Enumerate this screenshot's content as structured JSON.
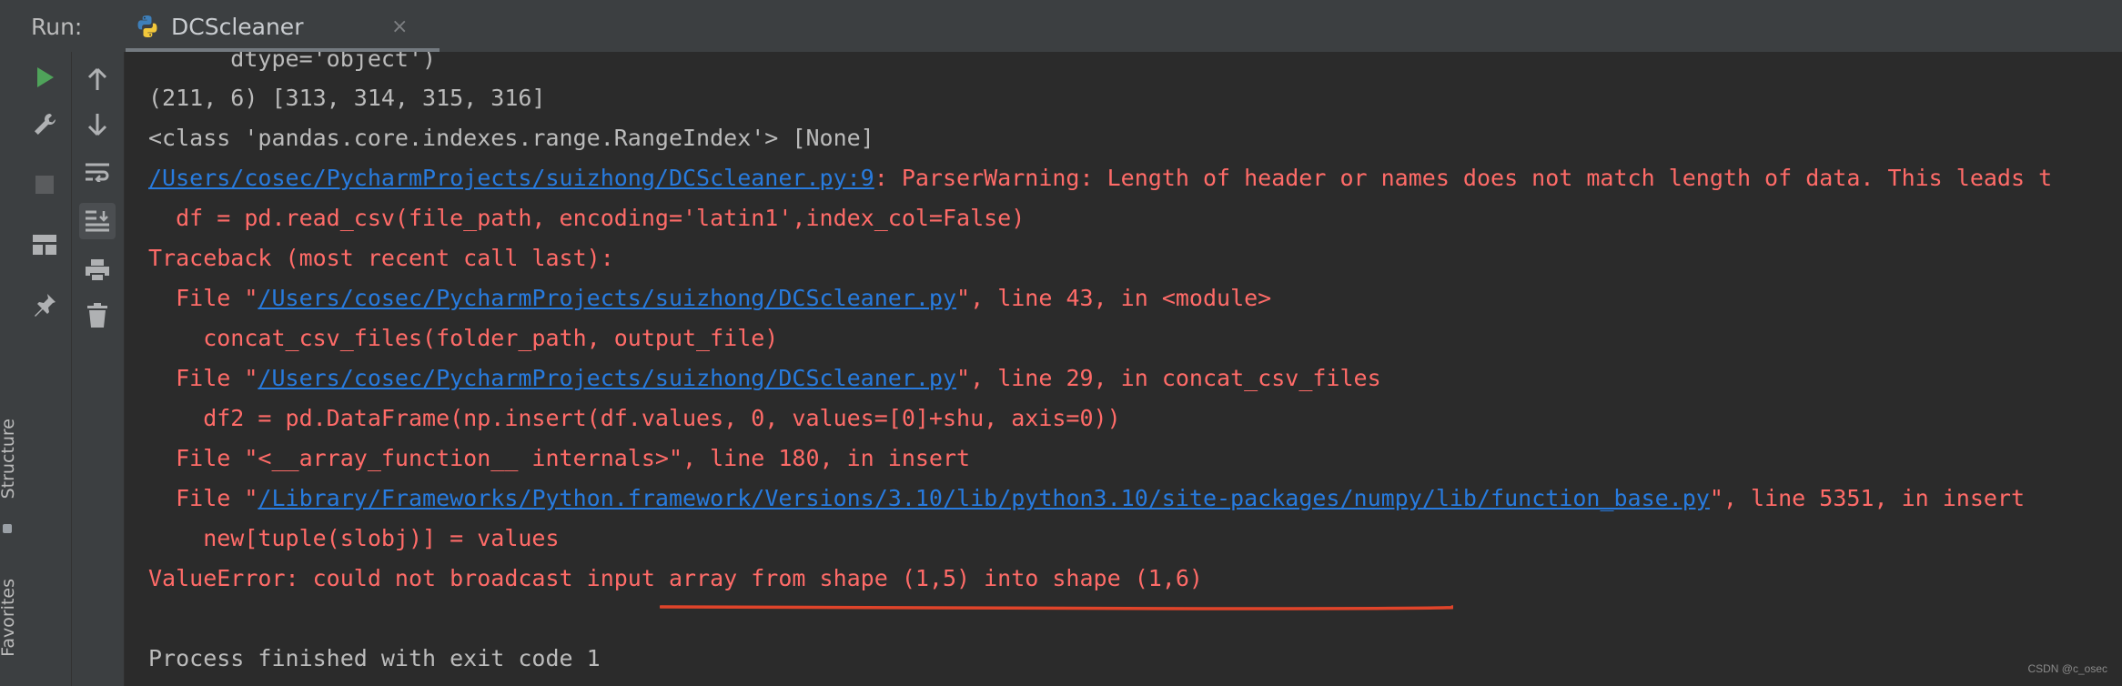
{
  "run_panel": {
    "label": "Run:",
    "tab": {
      "title": "DCScleaner",
      "close_glyph": "×",
      "icon": "python-icon"
    }
  },
  "side_tabs": [
    {
      "label": "Structure"
    },
    {
      "label": "Favorites"
    }
  ],
  "toolbar_left": [
    {
      "name": "rerun-icon",
      "tooltip": "Rerun"
    },
    {
      "name": "wrench-icon",
      "tooltip": "Edit Configuration"
    },
    {
      "name": "stop-icon",
      "tooltip": "Stop"
    },
    {
      "name": "layout-icon",
      "tooltip": "Restore Layout"
    },
    {
      "name": "pin-icon",
      "tooltip": "Pin Tab"
    }
  ],
  "toolbar_right": [
    {
      "name": "arrow-up-icon"
    },
    {
      "name": "arrow-down-icon"
    },
    {
      "name": "soft-wrap-icon"
    },
    {
      "name": "scroll-to-end-icon"
    },
    {
      "name": "print-icon"
    },
    {
      "name": "trash-icon"
    }
  ],
  "console": {
    "line0": "      dtype='object')",
    "line1": "(211, 6) [313, 314, 315, 316]",
    "line2": "<class 'pandas.core.indexes.range.RangeIndex'> [None]",
    "line3_link": "/Users/cosec/PycharmProjects/suizhong/DCScleaner.py:9",
    "line3_text": ": ParserWarning: Length of header or names does not match length of data. This leads t",
    "line4": "  df = pd.read_csv(file_path, encoding='latin1',index_col=False)",
    "line5": "Traceback (most recent call last):",
    "line6_pre": "  File \"",
    "line6_link": "/Users/cosec/PycharmProjects/suizhong/DCScleaner.py",
    "line6_post": "\", line 43, in <module>",
    "line7": "    concat_csv_files(folder_path, output_file)",
    "line8_pre": "  File \"",
    "line8_link": "/Users/cosec/PycharmProjects/suizhong/DCScleaner.py",
    "line8_post": "\", line 29, in concat_csv_files",
    "line9": "    df2 = pd.DataFrame(np.insert(df.values, 0, values=[0]+shu, axis=0))",
    "line10": "  File \"<__array_function__ internals>\", line 180, in insert",
    "line11_pre": "  File \"",
    "line11_link": "/Library/Frameworks/Python.framework/Versions/3.10/lib/python3.10/site-packages/numpy/lib/function_base.py",
    "line11_post": "\", line 5351, in insert",
    "line12": "    new[tuple(slobj)] = values",
    "line13": "ValueError: could not broadcast input array from shape (1,5) into shape (1,6)",
    "line14": "",
    "line15": "Process finished with exit code 1"
  },
  "watermark": "CSDN @c_osec",
  "colors": {
    "background": "#2b2b2b",
    "panel": "#3c3f41",
    "stdout": "#bbbbbb",
    "stderr": "#ff6b68",
    "link": "#287bde",
    "annotation": "#e0442a"
  }
}
